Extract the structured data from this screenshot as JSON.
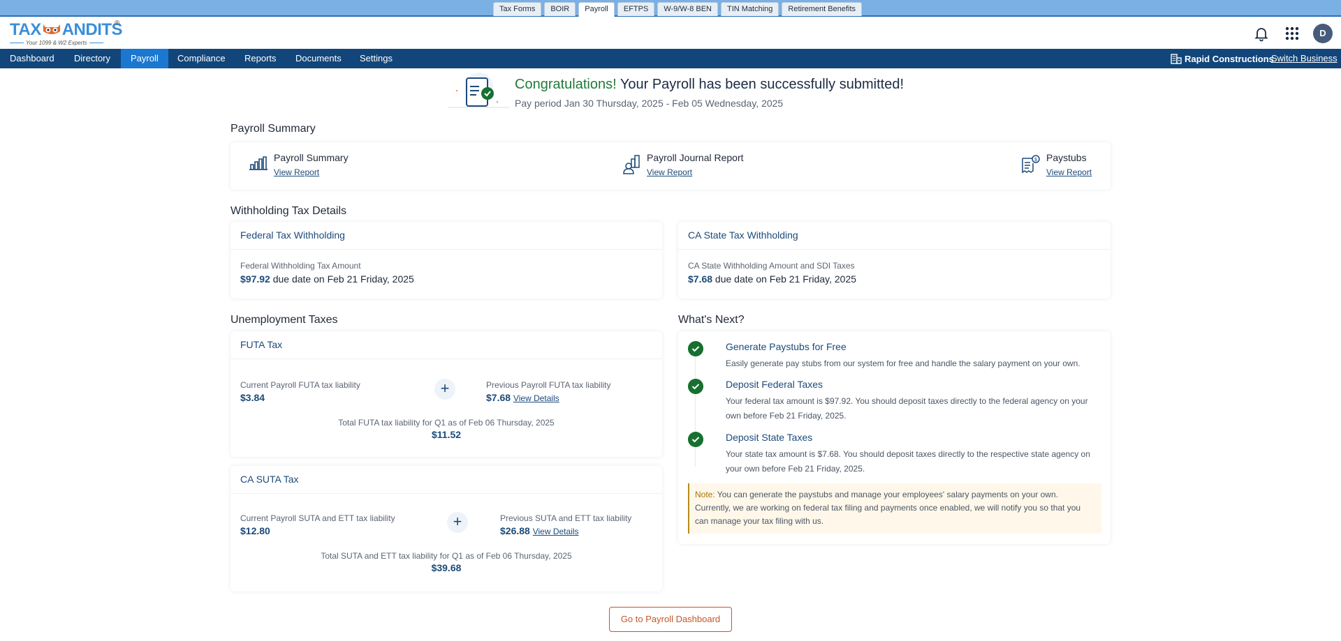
{
  "product_tabs": [
    "Tax Forms",
    "BOIR",
    "Payroll",
    "EFTPS",
    "W-9/W-8 BEN",
    "TIN Matching",
    "Retirement Benefits"
  ],
  "product_tab_active": "Payroll",
  "logo": {
    "brand": "TAXBANDITS",
    "tagline": "Your 1099 & W2 Experts",
    "reg": "®"
  },
  "header": {
    "avatar_initial": "D"
  },
  "nav": {
    "items": [
      "Dashboard",
      "Directory",
      "Payroll",
      "Compliance",
      "Reports",
      "Documents",
      "Settings"
    ],
    "active": "Payroll",
    "business_name": "Rapid Constructions",
    "switch_business": "Switch Business"
  },
  "banner": {
    "congrats": "Congratulations!",
    "message": " Your Payroll has been successfully submitted!",
    "pay_period": "Pay period Jan 30 Thursday, 2025 - Feb 05 Wednesday, 2025"
  },
  "payroll_summary": {
    "title": "Payroll Summary",
    "reports": [
      {
        "name": "Payroll Summary",
        "link": "View Report",
        "icon": "bar-chart-icon"
      },
      {
        "name": "Payroll Journal Report",
        "link": "View Report",
        "icon": "journal-report-icon"
      },
      {
        "name": "Paystubs",
        "link": "View Report",
        "icon": "paystub-icon"
      }
    ]
  },
  "withholding": {
    "title": "Withholding Tax Details",
    "federal": {
      "title": "Federal Tax Withholding",
      "label": "Federal Withholding Tax Amount",
      "amount": "$97.92",
      "due": " due date on Feb 21 Friday, 2025"
    },
    "state": {
      "title": "CA State Tax Withholding",
      "label": "CA State Withholding Amount and SDI Taxes",
      "amount": "$7.68",
      "due": " due date on Feb 21 Friday, 2025"
    }
  },
  "unemployment": {
    "title": "Unemployment Taxes",
    "futa": {
      "title": "FUTA Tax",
      "current_label": "Current Payroll FUTA tax liability",
      "current_amount": "$3.84",
      "previous_label": "Previous Payroll FUTA tax liability",
      "previous_amount": "$7.68",
      "view_details": "View Details",
      "total_label": "Total FUTA tax liability for Q1 as of Feb 06 Thursday, 2025",
      "total_amount": "$11.52"
    },
    "suta": {
      "title": "CA SUTA Tax",
      "current_label": "Current Payroll SUTA and ETT tax liability",
      "current_amount": "$12.80",
      "previous_label": "Previous SUTA and ETT tax liability",
      "previous_amount": "$26.88",
      "view_details": "View Details",
      "total_label": "Total SUTA and ETT tax liability for Q1 as of Feb 06 Thursday, 2025",
      "total_amount": "$39.68"
    }
  },
  "whats_next": {
    "title": "What's Next?",
    "steps": [
      {
        "title": "Generate Paystubs for Free",
        "desc": "Easily generate pay stubs from our system for free and handle the salary payment on your own."
      },
      {
        "title": "Deposit Federal Taxes",
        "desc": "Your federal tax amount is $97.92. You should deposit taxes directly to the federal agency on your own before Feb 21 Friday, 2025."
      },
      {
        "title": "Deposit State Taxes",
        "desc": "Your state tax amount is $7.68. You should deposit taxes directly to the respective state agency on your own before Feb 21 Friday, 2025."
      }
    ],
    "note_label": "Note:",
    "note_text": " You can generate the paystubs and manage your employees' salary payments on your own. Currently, we are working on federal tax filing and payments once enabled, we will notify you so that you can manage your tax filing with us."
  },
  "go_button": "Go to Payroll Dashboard",
  "colors": {
    "nav_bg": "#12467a",
    "nav_active": "#1b78d0",
    "accent_green": "#17702f",
    "link_blue": "#1c4a7a",
    "cta_orange": "#c0582a",
    "note_bg": "#fff8ea"
  }
}
